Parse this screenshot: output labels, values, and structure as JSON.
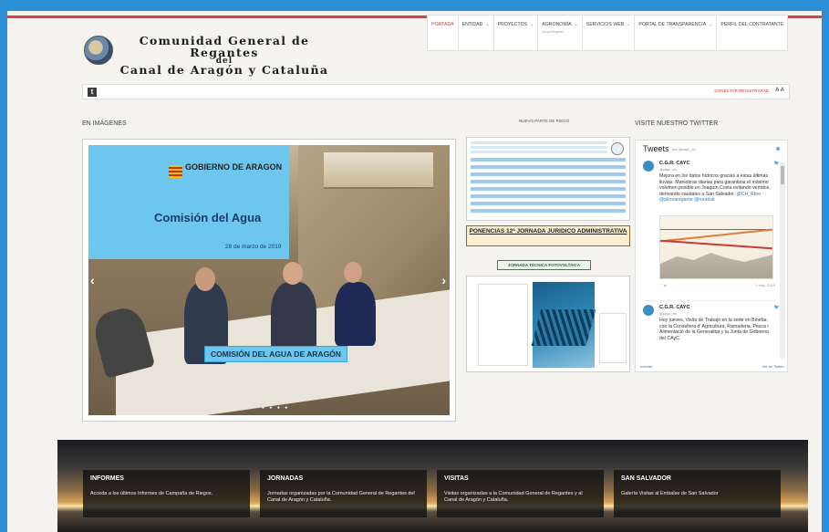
{
  "nav": {
    "items": [
      {
        "label": "PORTADA",
        "chevron": false
      },
      {
        "label": "ENTIDAD",
        "chevron": true
      },
      {
        "label": "PROYECTOS",
        "chevron": true
      },
      {
        "label": "AGRONOMÍA",
        "chevron": true,
        "sub": "Zona Regable"
      },
      {
        "label": "SERVICIOS WEB",
        "chevron": true
      },
      {
        "label": "PORTAL DE TRANSPARENCIA",
        "chevron": true
      },
      {
        "label": "PERFIL DEL CONTRATANTE",
        "chevron": false
      }
    ],
    "chevron_glyph": "⌄"
  },
  "brand": {
    "line1": "Comunidad General de Regantes",
    "line2": "del",
    "line3": "Canal de Aragón y Cataluña"
  },
  "toolbar": {
    "twitter_glyph": "t",
    "login": "CONECTAR REGISTRARSE",
    "font_size": "A A"
  },
  "sections": {
    "images": "EN IMÁGENES",
    "riego": "NUEVO PARTE DE RIEGO",
    "twitter": "VISITE NUESTRO TWITTER"
  },
  "slide": {
    "gobierno": "GOBIERNO DE ARAGON",
    "comision": "Comisión del Agua",
    "fecha": "28 de marzo de 2019",
    "caption": "COMISIÓN DEL AGUA DE ARAGÓN",
    "prev": "‹",
    "next": "›",
    "dots": "● ● ● ●"
  },
  "center": {
    "ponencias": "PONENCIAS 12ª JORNADA JURIDICO ADMINISTRATIVA",
    "jornada": "JORNADA TÉCNICA FOTOVOLTAICA"
  },
  "twitter": {
    "header": "Tweets",
    "by": "por @cayc_es",
    "tweet1": {
      "name": "C.G.R. CAYC",
      "handle": "@cayc_es",
      "bird": "🐦",
      "text": "Mejora en los datos hídricos gracias a estas últimas lluvias. Maniobras diarias para garantizar el máximo volumen posible en Joaquín Costa evitando vertidos, derivando caudales a San Salvador.",
      "mentions": "@CH_Ebro @pilonaregante @ruralcat",
      "date": "3 may. 2019"
    },
    "tweet2": {
      "name": "C.G.R. CAYC",
      "handle": "@cayc_es",
      "bird": "🐦",
      "text": "Hoy jueves, Visita de Trabajo en la sede en Binéfar, con la Consellera d' Agricultura, Ramaderia, Pesca i Alimentació de la Generalitat y la Junta de Gobierno del CAyC."
    },
    "footer_left": "Insertar",
    "footer_right": "Ver en Twitter"
  },
  "tiles": [
    {
      "title": "INFORMES",
      "text": "Acceda a los últimos Informes de Campaña de Riegos."
    },
    {
      "title": "JORNADAS",
      "text": "Jornadas organizadas por la Comunidad General de Regantes del Canal de Aragón y Cataluña."
    },
    {
      "title": "VISITAS",
      "text": "Visitas organizadas a la Comunidad General de Regantes y al Canal de Aragón y Cataluña."
    },
    {
      "title": "SAN SALVADOR",
      "text": "Galería Visitas al Embalse de San Salvador"
    }
  ]
}
